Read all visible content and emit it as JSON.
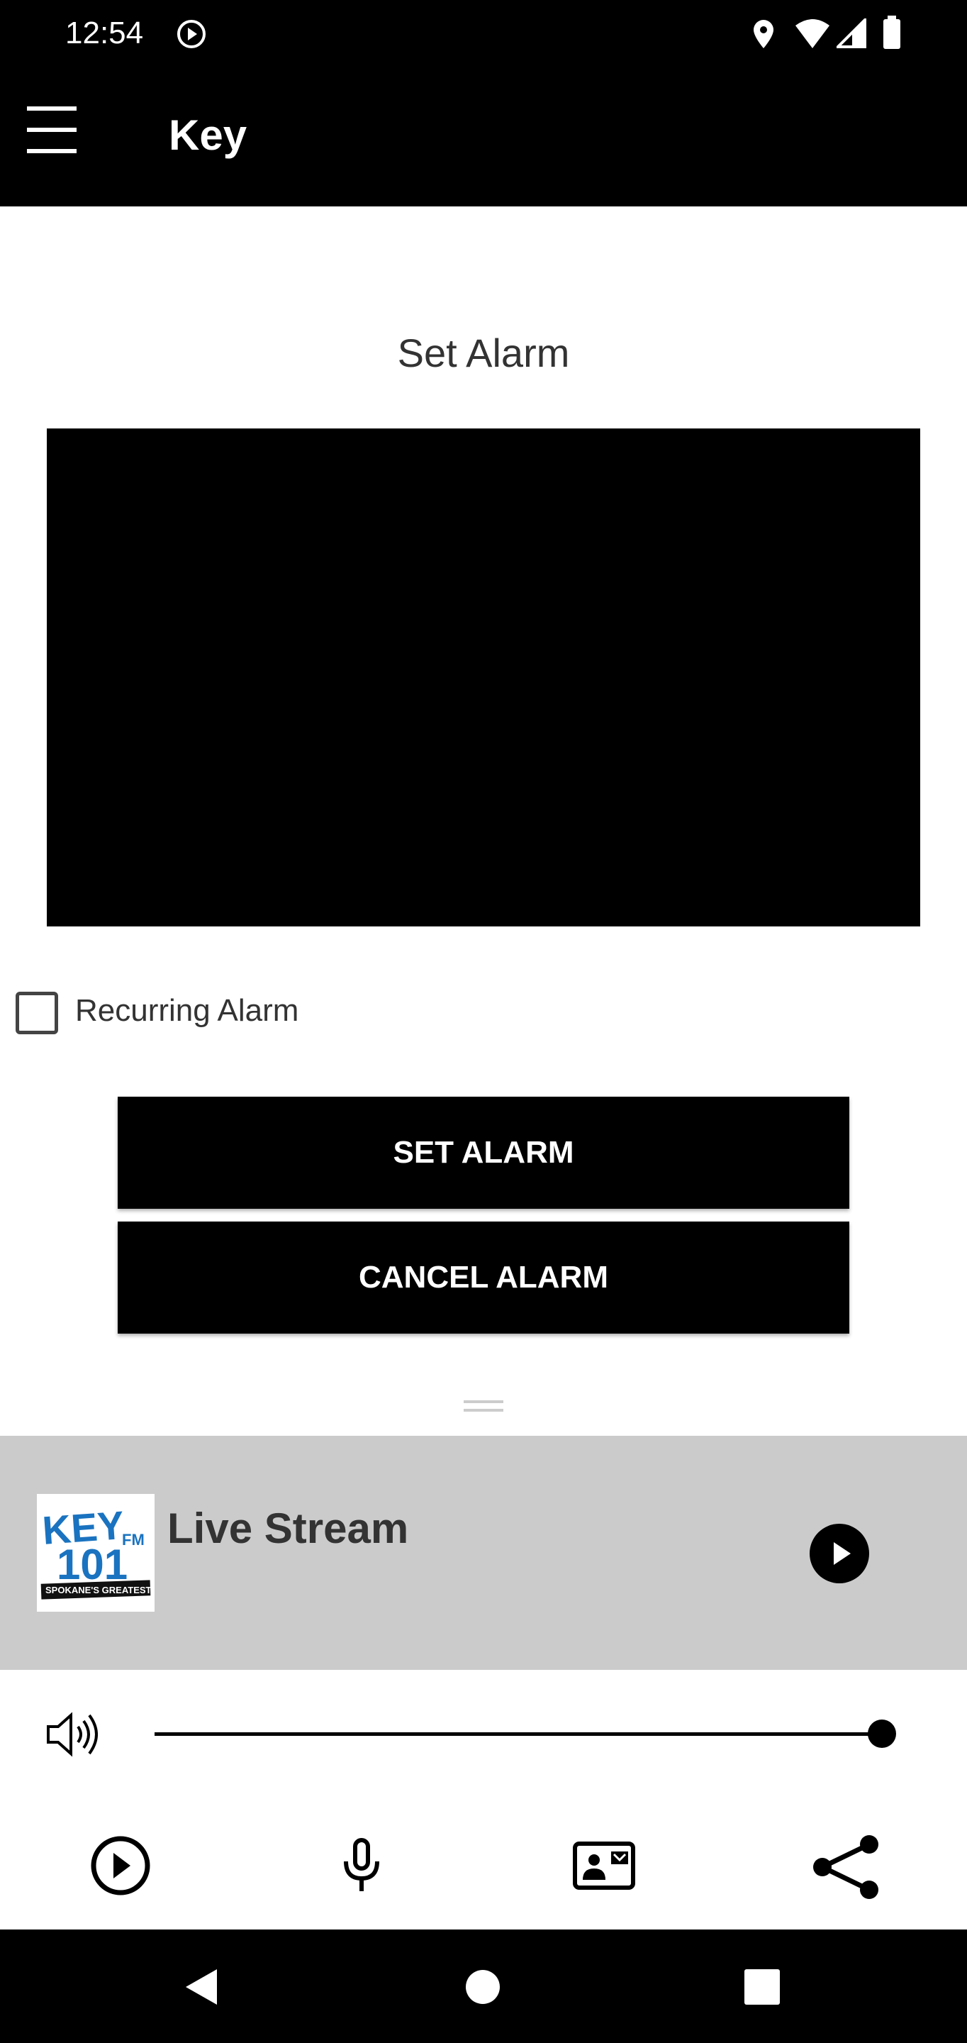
{
  "status_bar": {
    "time": "12:54"
  },
  "app_bar": {
    "title": "Key"
  },
  "alarm": {
    "heading": "Set Alarm",
    "recurring_label": "Recurring Alarm",
    "recurring_checked": false,
    "set_label": "SET ALARM",
    "cancel_label": "CANCEL ALARM"
  },
  "player": {
    "title": "Live Stream",
    "logo_text": [
      "KEY",
      "FM",
      "101",
      "SPOKANE'S GREATEST HITS"
    ],
    "volume_percent": 100
  },
  "colors": {
    "bar": "#000000",
    "panel": "#cbcbcb",
    "logo_blue": "#1a73c0"
  },
  "bottom_icons": [
    "play-circle-icon",
    "microphone-icon",
    "contact-card-icon",
    "share-icon"
  ]
}
